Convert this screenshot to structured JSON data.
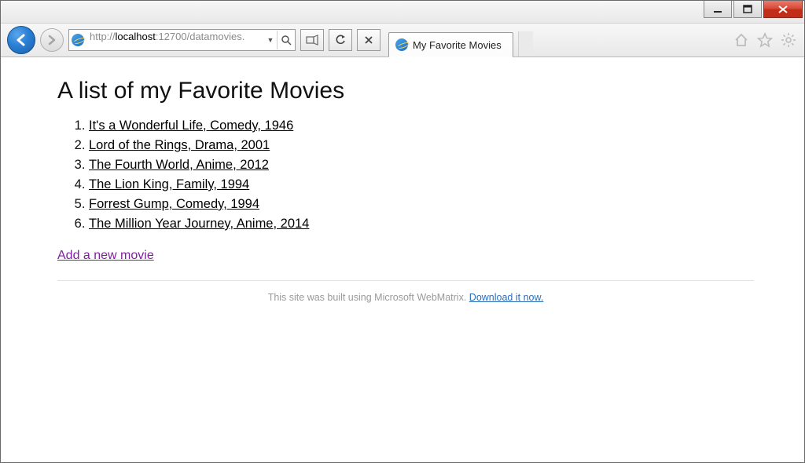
{
  "window": {
    "url_plain": "http://",
    "url_host": "localhost",
    "url_rest": ":12700/datamovies."
  },
  "tab": {
    "title": "My Favorite Movies"
  },
  "page": {
    "heading": "A list of my Favorite Movies",
    "movies": [
      "It's a Wonderful Life, Comedy, 1946",
      "Lord of the Rings, Drama, 2001",
      "The Fourth World, Anime, 2012",
      "The Lion King, Family, 1994",
      "Forrest Gump, Comedy, 1994",
      "The Million Year Journey, Anime, 2014"
    ],
    "add_link": "Add a new movie",
    "footer_text": "This site was built using Microsoft WebMatrix. ",
    "footer_link": "Download it now."
  }
}
